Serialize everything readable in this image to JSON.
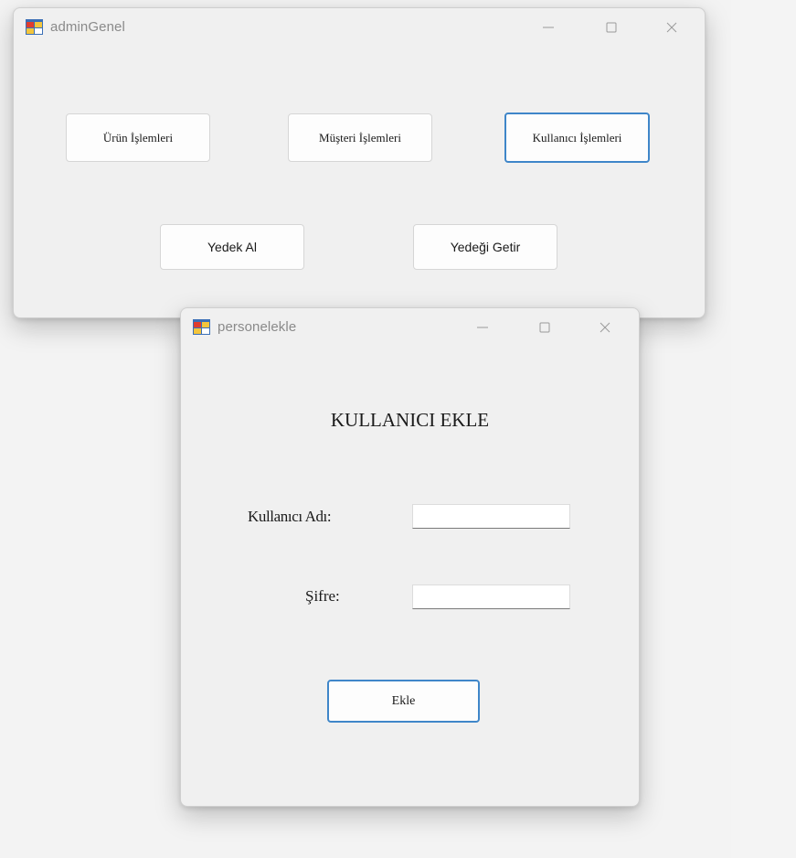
{
  "admin_window": {
    "title": "adminGenel",
    "buttons": {
      "urun": "Ürün İşlemleri",
      "musteri": "Müşteri İşlemleri",
      "kullanici": "Kullanıcı İşlemleri",
      "yedek_al": "Yedek Al",
      "yedegi_getir": "Yedeği Getir"
    }
  },
  "personel_window": {
    "title": "personelekle",
    "heading": "KULLANICI EKLE",
    "username_label": "Kullanıcı Adı:",
    "username_value": "",
    "password_label": "Şifre:",
    "password_value": "",
    "submit_label": "Ekle"
  },
  "icons": [
    "app-icon",
    "minimize-icon",
    "maximize-icon",
    "close-icon"
  ]
}
